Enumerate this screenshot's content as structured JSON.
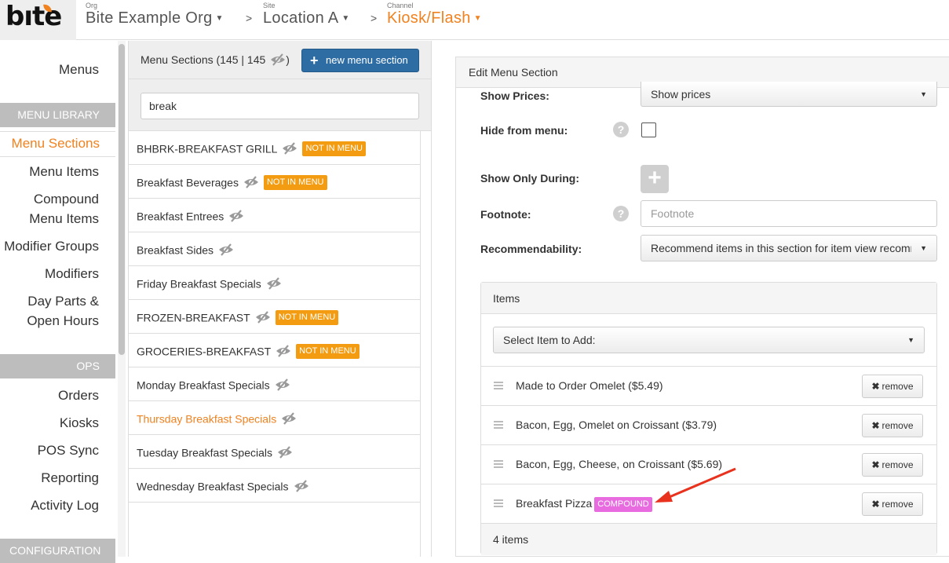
{
  "header": {
    "logo": "bite",
    "org": {
      "label": "Org",
      "value": "Bite Example Org"
    },
    "site": {
      "label": "Site",
      "value": "Location A"
    },
    "channel": {
      "label": "Channel",
      "value": "Kiosk/Flash"
    },
    "separator": ">",
    "accent_color": "#f08220"
  },
  "leftnav": {
    "menus": "Menus",
    "library_heading": "MENU LIBRARY",
    "library_items": [
      "Menu Sections",
      "Menu Items",
      "Compound",
      "Menu Items",
      "Modifier Groups",
      "Modifiers",
      "Day Parts &",
      "Open Hours"
    ],
    "ops_heading": "OPS",
    "ops_items": [
      "Orders",
      "Kiosks",
      "POS Sync",
      "Reporting",
      "Activity Log"
    ],
    "config_heading": "CONFIGURATION"
  },
  "sections_panel": {
    "title": "Menu Sections (145 | 145",
    "title_suffix": ")",
    "new_button": "new menu section",
    "search_value": "break",
    "not_in_menu_label": "NOT IN MENU",
    "rows": [
      {
        "name": "BHBRK-BREAKFAST GRILL",
        "not_in_menu": true
      },
      {
        "name": "Breakfast Beverages",
        "not_in_menu": true
      },
      {
        "name": "Breakfast Entrees",
        "not_in_menu": false
      },
      {
        "name": "Breakfast Sides",
        "not_in_menu": false
      },
      {
        "name": "Friday Breakfast Specials",
        "not_in_menu": false
      },
      {
        "name": "FROZEN-BREAKFAST",
        "not_in_menu": true
      },
      {
        "name": "GROCERIES-BREAKFAST",
        "not_in_menu": true
      },
      {
        "name": "Monday Breakfast Specials",
        "not_in_menu": false
      },
      {
        "name": "Thursday Breakfast Specials",
        "not_in_menu": false,
        "active": true
      },
      {
        "name": "Tuesday Breakfast Specials",
        "not_in_menu": false
      },
      {
        "name": "Wednesday Breakfast Specials",
        "not_in_menu": false
      }
    ]
  },
  "edit_panel": {
    "title": "Edit Menu Section",
    "show_prices_label": "Show Prices:",
    "show_prices_value": "Show prices",
    "hide_label": "Hide from menu:",
    "hide_checked": false,
    "show_only_label": "Show Only During:",
    "footnote_label": "Footnote:",
    "footnote_placeholder": "Footnote",
    "recommend_label": "Recommendability:",
    "recommend_value": "Recommend items in this section for item view recommendations",
    "help_glyph": "?",
    "items": {
      "heading": "Items",
      "add_placeholder": "Select Item to Add:",
      "remove_label": "remove",
      "compound_label": "COMPOUND",
      "rows": [
        {
          "name": "Made to Order Omelet ($5.49)",
          "compound": false
        },
        {
          "name": "Bacon, Egg, Omelet on Croissant ($3.79)",
          "compound": false
        },
        {
          "name": "Bacon, Egg, Cheese, on Croissant ($5.69)",
          "compound": false
        },
        {
          "name": "Breakfast Pizza",
          "compound": true
        }
      ],
      "footer": "4 items"
    }
  },
  "annotation_color": "#e8321e"
}
